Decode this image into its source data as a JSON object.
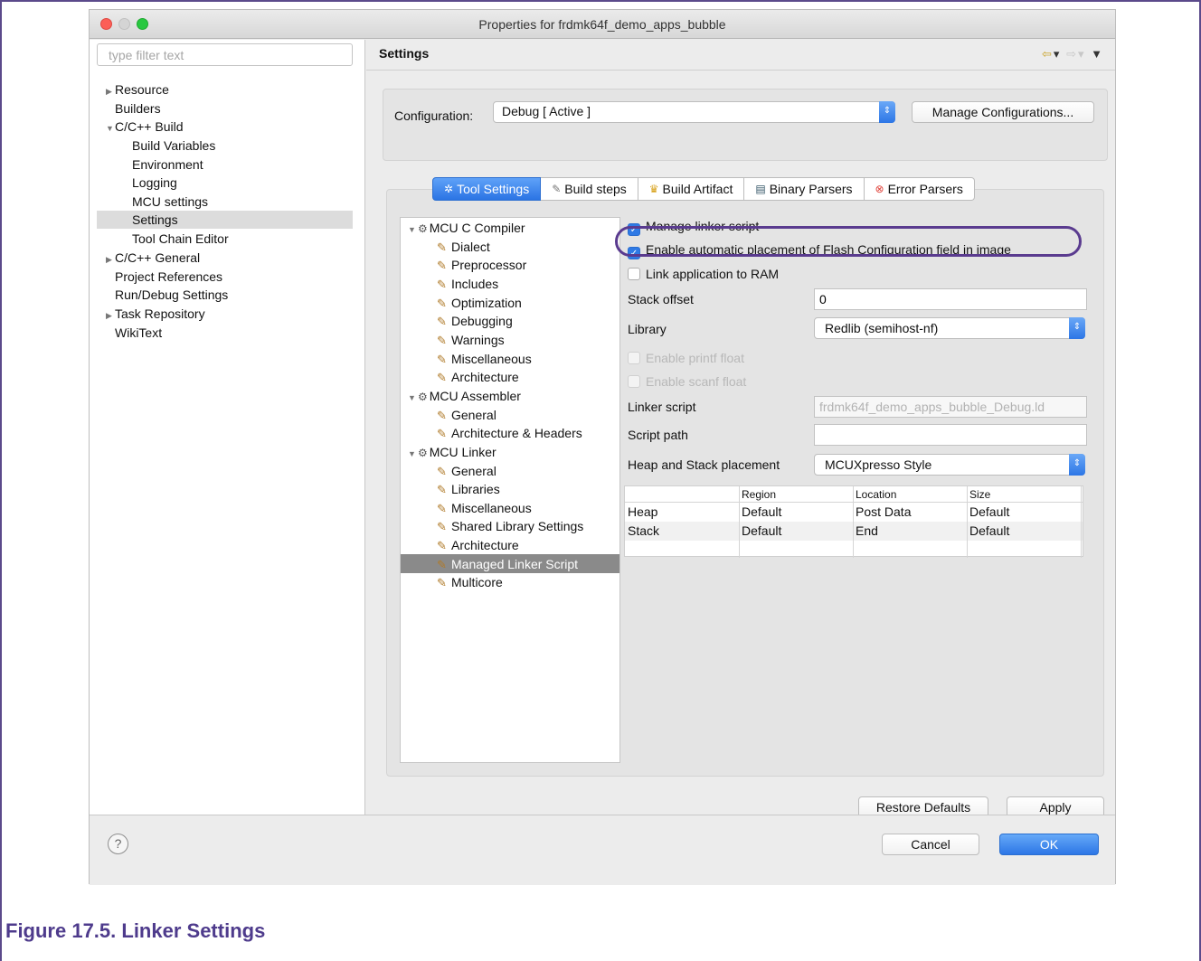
{
  "window": {
    "title": "Properties for frdmk64f_demo_apps_bubble"
  },
  "left_nav": {
    "filter_placeholder": "type filter text",
    "items": [
      {
        "label": "Resource",
        "indent": 0,
        "collapsed": true
      },
      {
        "label": "Builders",
        "indent": 0
      },
      {
        "label": "C/C++ Build",
        "indent": 0,
        "expanded": true
      },
      {
        "label": "Build Variables",
        "indent": 1
      },
      {
        "label": "Environment",
        "indent": 1
      },
      {
        "label": "Logging",
        "indent": 1
      },
      {
        "label": "MCU settings",
        "indent": 1
      },
      {
        "label": "Settings",
        "indent": 1,
        "selected": true
      },
      {
        "label": "Tool Chain Editor",
        "indent": 1
      },
      {
        "label": "C/C++ General",
        "indent": 0,
        "collapsed": true
      },
      {
        "label": "Project References",
        "indent": 0
      },
      {
        "label": "Run/Debug Settings",
        "indent": 0
      },
      {
        "label": "Task Repository",
        "indent": 0,
        "collapsed": true
      },
      {
        "label": "WikiText",
        "indent": 0
      }
    ]
  },
  "settings": {
    "title": "Settings",
    "config_label": "Configuration:",
    "config_value": "Debug  [ Active ]",
    "manage_button": "Manage Configurations...",
    "tabs": [
      {
        "label": "Tool Settings",
        "icon": "tool-settings-icon",
        "active": true
      },
      {
        "label": "Build steps",
        "icon": "build-steps-icon"
      },
      {
        "label": "Build Artifact",
        "icon": "build-artifact-icon"
      },
      {
        "label": "Binary Parsers",
        "icon": "binary-parsers-icon"
      },
      {
        "label": "Error Parsers",
        "icon": "error-parsers-icon"
      }
    ],
    "tool_tree": [
      {
        "label": "MCU C Compiler",
        "level": 0
      },
      {
        "label": "Dialect",
        "level": 1
      },
      {
        "label": "Preprocessor",
        "level": 1
      },
      {
        "label": "Includes",
        "level": 1
      },
      {
        "label": "Optimization",
        "level": 1
      },
      {
        "label": "Debugging",
        "level": 1
      },
      {
        "label": "Warnings",
        "level": 1
      },
      {
        "label": "Miscellaneous",
        "level": 1
      },
      {
        "label": "Architecture",
        "level": 1
      },
      {
        "label": "MCU Assembler",
        "level": 0
      },
      {
        "label": "General",
        "level": 1
      },
      {
        "label": "Architecture & Headers",
        "level": 1
      },
      {
        "label": "MCU Linker",
        "level": 0
      },
      {
        "label": "General",
        "level": 1
      },
      {
        "label": "Libraries",
        "level": 1
      },
      {
        "label": "Miscellaneous",
        "level": 1
      },
      {
        "label": "Shared Library Settings",
        "level": 1
      },
      {
        "label": "Architecture",
        "level": 1
      },
      {
        "label": "Managed Linker Script",
        "level": 1,
        "selected": true
      },
      {
        "label": "Multicore",
        "level": 1
      }
    ],
    "options": {
      "manage_linker_script": {
        "label": "Manage linker script",
        "checked": true
      },
      "flash_config": {
        "label": "Enable automatic placement of Flash Configuration field in image",
        "checked": true
      },
      "link_to_ram": {
        "label": "Link application to RAM",
        "checked": false
      },
      "stack_offset_label": "Stack offset",
      "stack_offset_value": "0",
      "library_label": "Library",
      "library_value": "Redlib (semihost-nf)",
      "printf_float": {
        "label": "Enable printf float",
        "checked": false,
        "disabled": true
      },
      "scanf_float": {
        "label": "Enable scanf float",
        "checked": false,
        "disabled": true
      },
      "linker_script_label": "Linker script",
      "linker_script_value": "frdmk64f_demo_apps_bubble_Debug.ld",
      "script_path_label": "Script path",
      "script_path_value": "",
      "heap_stack_label": "Heap and Stack placement",
      "heap_stack_value": "MCUXpresso Style"
    },
    "placement_table": {
      "headers": [
        "",
        "Region",
        "Location",
        "Size"
      ],
      "rows": [
        [
          "Heap",
          "Default",
          "Post Data",
          "Default"
        ],
        [
          "Stack",
          "Default",
          "End",
          "Default"
        ]
      ]
    },
    "restore_defaults": "Restore Defaults",
    "apply": "Apply"
  },
  "dialog_buttons": {
    "help": "?",
    "cancel": "Cancel",
    "ok": "OK"
  },
  "caption": "Figure 17.5. Linker Settings",
  "colors": {
    "accent_blue": "#2c76e6",
    "highlight_oval": "#5a3b8f",
    "caption": "#4e3b8c"
  }
}
